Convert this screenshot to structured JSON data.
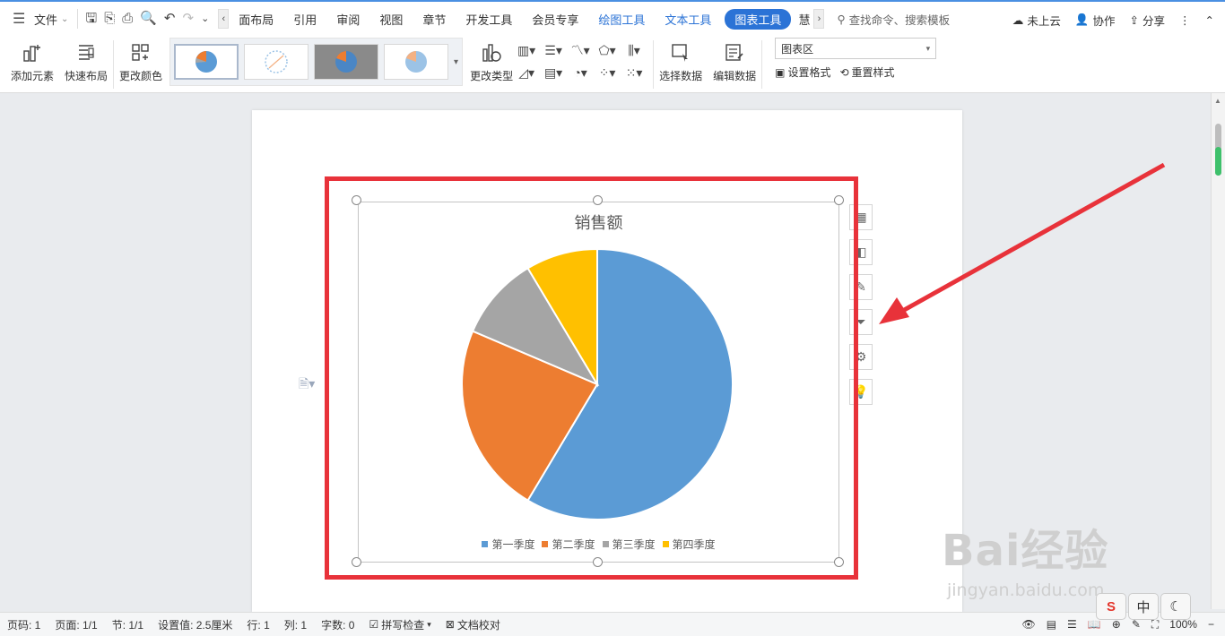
{
  "menubar": {
    "file_label": "文件",
    "tabs": [
      "面布局",
      "引用",
      "审阅",
      "视图",
      "章节",
      "开发工具",
      "会员专享",
      "绘图工具",
      "文本工具",
      "图表工具",
      "慧"
    ],
    "search_placeholder": "查找命令、搜索模板",
    "cloud_label": "未上云",
    "collab_label": "协作",
    "share_label": "分享"
  },
  "ribbon": {
    "add_element": "添加元素",
    "quick_layout": "快速布局",
    "change_color": "更改颜色",
    "change_type": "更改类型",
    "select_data": "选择数据",
    "edit_data": "编辑数据",
    "chart_area_dropdown": "图表区",
    "set_format": "设置格式",
    "reset_style": "重置样式"
  },
  "chart_data": {
    "type": "pie",
    "title": "销售额",
    "categories": [
      "第一季度",
      "第二季度",
      "第三季度",
      "第四季度"
    ],
    "values": [
      8.2,
      3.2,
      1.4,
      1.2
    ],
    "colors": [
      "#5b9bd5",
      "#ed7d31",
      "#a5a5a5",
      "#ffc000"
    ],
    "legend": "bottom"
  },
  "statusbar": {
    "page_no": "页码: 1",
    "pages": "页面: 1/1",
    "section": "节: 1/1",
    "setting": "设置值: 2.5厘米",
    "row": "行: 1",
    "col": "列: 1",
    "words": "字数: 0",
    "spellcheck": "拼写检查",
    "proofread": "文档校对",
    "zoom": "100%"
  },
  "watermark": {
    "brand": "Bai经验",
    "url": "jingyan.baidu.com"
  },
  "ime": {
    "mode": "中"
  }
}
